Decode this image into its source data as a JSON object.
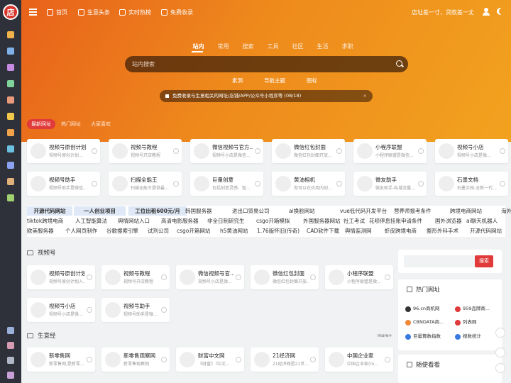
{
  "brand": {
    "logo_char": "店"
  },
  "topnav": [
    {
      "label": "首页",
      "icon": "home-icon"
    },
    {
      "label": "生意头条",
      "icon": "bulb-icon"
    },
    {
      "label": "实时热榜",
      "icon": "monitor-icon"
    },
    {
      "label": "免费收录",
      "icon": "globe-icon"
    }
  ],
  "slogan": "店址差一寸，贷款差一丈",
  "search": {
    "tabs": [
      "站内",
      "常用",
      "搜索",
      "工具",
      "社区",
      "生活",
      "求职"
    ],
    "active_tab": "站内",
    "placeholder": "站内搜索",
    "sublinks": [
      "素洞",
      "导航主题",
      "图标"
    ]
  },
  "notice": "免费收录与生意相关的网址/店铺/APP/公众号小程序等 (08/18)",
  "site_tabs": [
    "最新网址",
    "热门网址",
    "大家喜欢"
  ],
  "latest_cards": [
    {
      "title": "视频号原创计划",
      "desc": "视频号原创计划..."
    },
    {
      "title": "视频号教程",
      "desc": "视频号开店教程"
    },
    {
      "title": "微信视频号官方...",
      "desc": "视频号小店是微信..."
    },
    {
      "title": "微信红包封面",
      "desc": "微信红包封面开放..."
    },
    {
      "title": "小程序联盟",
      "desc": "小程序联盟是微信..."
    },
    {
      "title": "视频号小店",
      "desc": "视频号小店是微..."
    },
    {
      "title": "视频号助手",
      "desc": "视频号助手是微信..."
    },
    {
      "title": "扫描全能王",
      "desc": "扫描全能王提供最..."
    },
    {
      "title": "巨量创意",
      "desc": "包括创意灵感、智..."
    },
    {
      "title": "黄油相机",
      "desc": "你可以在应用内创..."
    },
    {
      "title": "微友助手",
      "desc": "微友助手-私域流量..."
    },
    {
      "title": "石墨文档",
      "desc": "石墨文档-全新一代..."
    }
  ],
  "hotlinks": [
    [
      "开源代码网站",
      "一人创业项目",
      "工位出租600元/月",
      "韩国服务器",
      "进出口贸易公司",
      "ai换脸网站",
      "vue低代码开发平台",
      "营养师报考条件",
      "跨境电商网站",
      "海外vps网站"
    ],
    [
      "tiktok跨境电商",
      "人工智能算法",
      "舆情网站入口",
      "高清电影服务器",
      "非全日制研究生",
      "csgo开箱模拟",
      "外国服务器网站",
      "社工考试",
      "花呗停息挂账申请条件",
      "国外浏览器",
      "ai聊天机器人"
    ],
    [
      "欧美服务器",
      "个人网页制作",
      "谷歌搜索引擎",
      "试剂公司",
      "csgo开箱网站",
      "h5黄油网站",
      "1.76版怀旧(传奇)",
      "CAD软件下载",
      "舆情监测网",
      "虾皮跨境电商",
      "整形外科手术",
      "开源代码网站"
    ]
  ],
  "sections": [
    {
      "title": "视频号",
      "cards": [
        {
          "title": "视频号原创计划",
          "desc": "视频号原创计划入..."
        },
        {
          "title": "视频号教程",
          "desc": "视频号开店教程"
        },
        {
          "title": "微信视频号官...",
          "desc": "视频号小店是微..."
        },
        {
          "title": "微信红包封面",
          "desc": "微信红包封面开放..."
        },
        {
          "title": "小程序联盟",
          "desc": "小程序联盟是微..."
        },
        {
          "title": "视频号小店",
          "desc": "视频号小店是微..."
        },
        {
          "title": "视频号助手",
          "desc": "视频号助手是微..."
        }
      ]
    },
    {
      "title": "生意经",
      "more": "more+",
      "cards": [
        {
          "title": "新零售网",
          "desc": "新零售网,是新零..."
        },
        {
          "title": "新零售观察网",
          "desc": "新零售观察网"
        },
        {
          "title": "财富中文网",
          "desc": "《财富》（中文..."
        },
        {
          "title": "21经济网",
          "desc": "21经济网是21世..."
        },
        {
          "title": "中国企业家",
          "desc": "中国企业家(m..."
        }
      ]
    }
  ],
  "right": {
    "search_button": "搜索",
    "hot_title": "热门网址",
    "hot_sites": [
      "96.cn商机网",
      "959品牌商...",
      "CBNDATA商...",
      "列表网",
      "巨量算数指数",
      "搜数统计"
    ],
    "random_title": "随便看看"
  },
  "colors": {
    "accent": "#e03a3a",
    "hero_start": "#e8621b",
    "hero_end": "#f2a21f",
    "sidebar": "#2e3139"
  }
}
